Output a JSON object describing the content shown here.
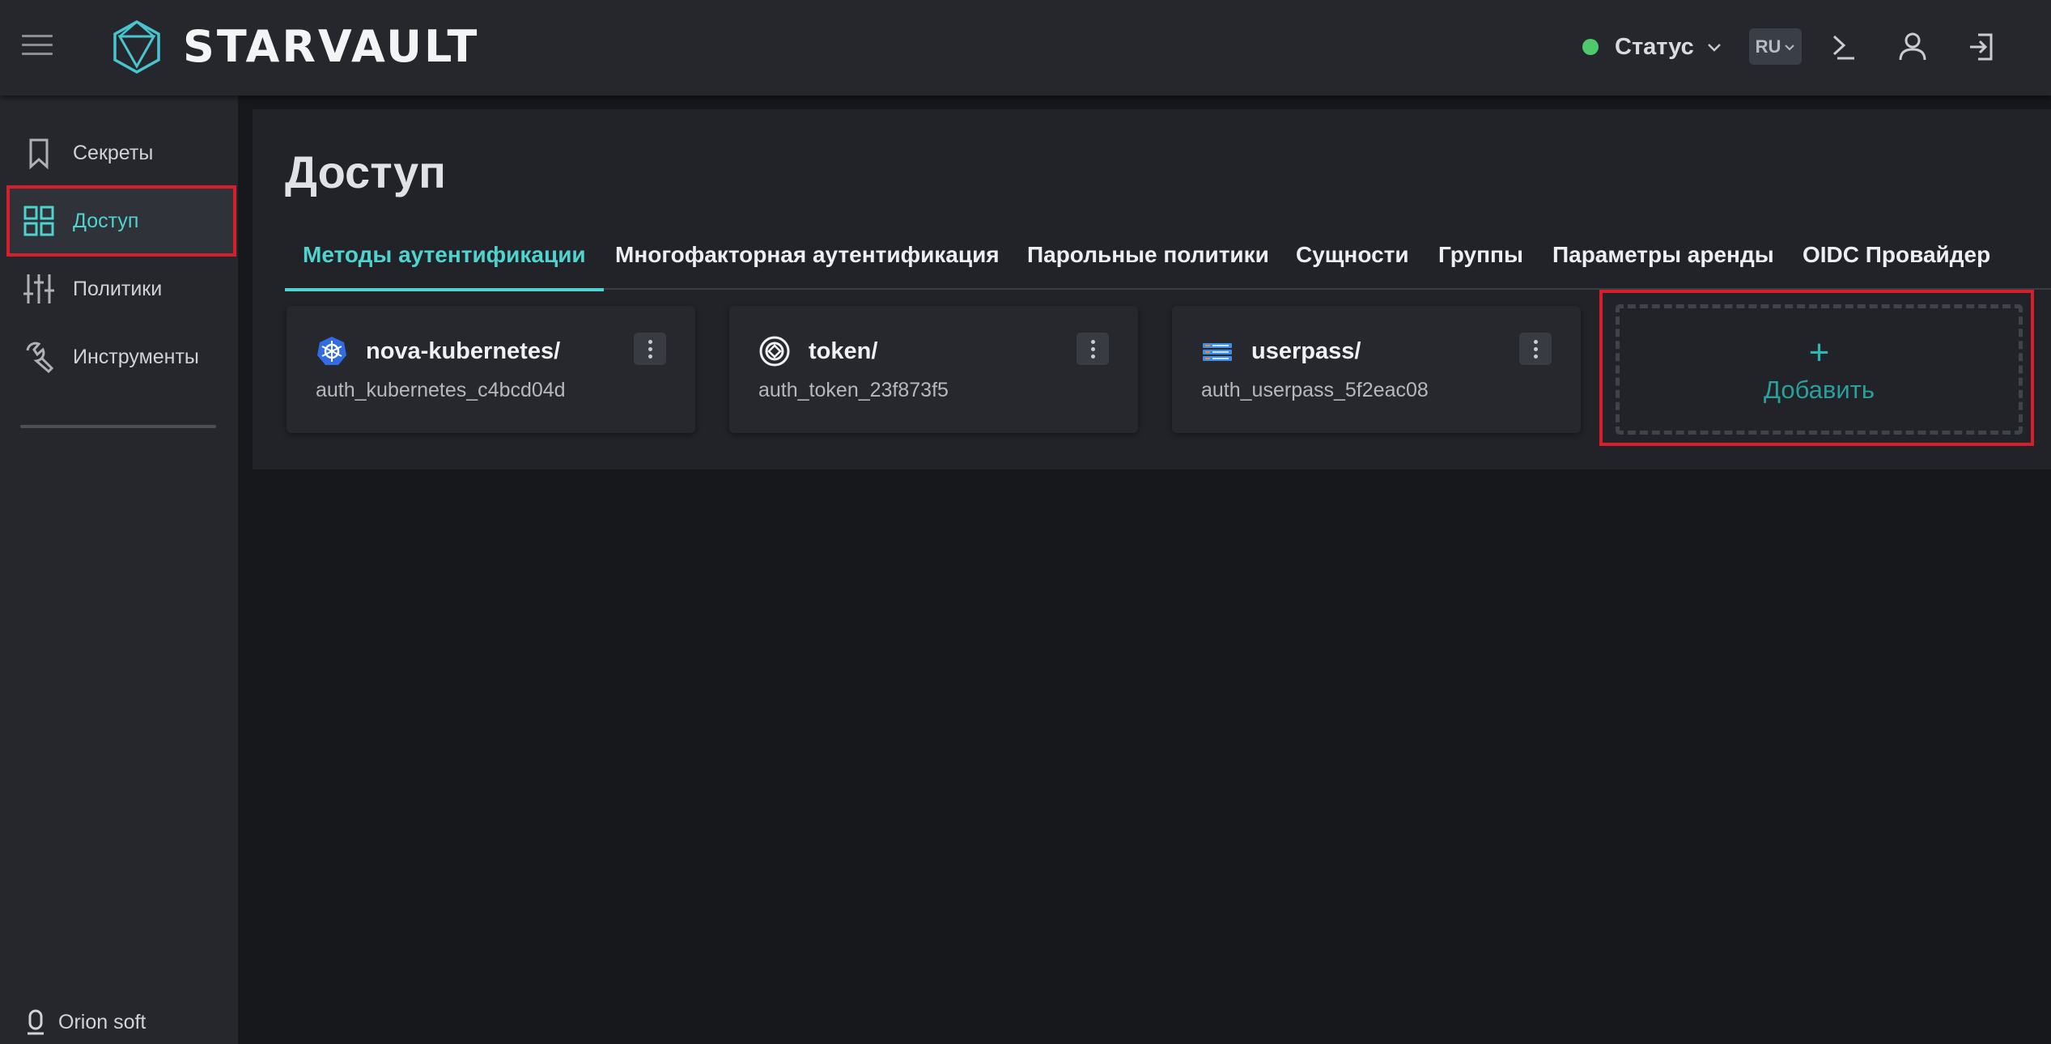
{
  "header": {
    "brand": "STARVAULT",
    "status_label": "Статус",
    "status_color": "#4fc96b",
    "language": "RU",
    "icons": [
      "menu-icon",
      "logo-icon",
      "terminal-icon",
      "user-icon",
      "logout-icon"
    ]
  },
  "sidebar": {
    "items": [
      {
        "label": "Секреты",
        "icon": "bookmark-icon"
      },
      {
        "label": "Доступ",
        "icon": "grid-icon",
        "active": true
      },
      {
        "label": "Политики",
        "icon": "sliders-icon"
      },
      {
        "label": "Инструменты",
        "icon": "wrench-icon"
      }
    ],
    "footer": "Orion soft"
  },
  "page": {
    "title": "Доступ",
    "tabs": [
      "Методы аутентификации",
      "Многофакторная аутентификация",
      "Парольные политики",
      "Сущности",
      "Группы",
      "Параметры аренды",
      "OIDC Провайдер"
    ],
    "active_tab": 0
  },
  "auth_methods": [
    {
      "title": "nova-kubernetes/",
      "accessor": "auth_kubernetes_c4bcd04d",
      "icon": "kubernetes-icon"
    },
    {
      "title": "token/",
      "accessor": "auth_token_23f873f5",
      "icon": "token-icon"
    },
    {
      "title": "userpass/",
      "accessor": "auth_userpass_5f2eac08",
      "icon": "userpass-icon"
    }
  ],
  "add_card": {
    "plus": "+",
    "label": "Добавить"
  },
  "colors": {
    "accent": "#4fd3cf",
    "highlight": "#d71f2b",
    "background": "#17181c",
    "panel": "#25272c"
  }
}
